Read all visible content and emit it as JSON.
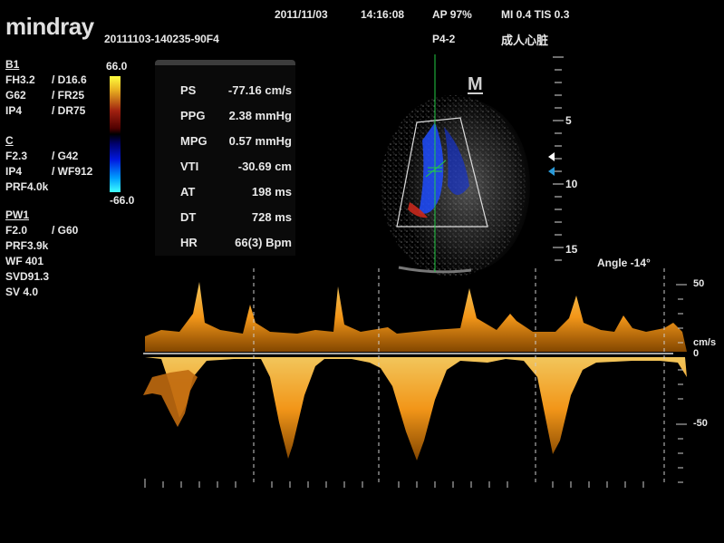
{
  "header": {
    "brand": "mindray",
    "file_id": "20111103-140235-90F4",
    "date": "2011/11/03",
    "time": "14:16:08",
    "ap": "AP  97%",
    "mi_tis": "MI 0.4  TIS 0.3",
    "probe": "P4-2",
    "exam": "成人心脏"
  },
  "params": {
    "b1": {
      "title": "B1",
      "r1a": "FH3.2",
      "r1b": "/ D16.6",
      "r2a": "G62",
      "r2b": "/ FR25",
      "r3a": "IP4",
      "r3b": "/ DR75"
    },
    "c": {
      "title": "C",
      "r1a": "F2.3",
      "r1b": "/ G42",
      "r2a": "IP4",
      "r2b": "/ WF912",
      "r3": "PRF4.0k"
    },
    "pw1": {
      "title": "PW1",
      "r1a": "F2.0",
      "r1b": "/ G60",
      "r2": "PRF3.9k",
      "r3": "WF 401",
      "r4": "SVD91.3",
      "r5": "SV 4.0"
    }
  },
  "color_scale": {
    "max": "66.0",
    "min": "-66.0"
  },
  "measurements": [
    {
      "label": "PS",
      "value": "-77.16 cm/s"
    },
    {
      "label": "PPG",
      "value": "2.38 mmHg"
    },
    {
      "label": "MPG",
      "value": "0.57 mmHg"
    },
    {
      "label": "VTI",
      "value": "-30.69 cm"
    },
    {
      "label": "AT",
      "value": "198 ms"
    },
    {
      "label": "DT",
      "value": "728 ms"
    },
    {
      "label": "HR",
      "value": "66(3) Bpm"
    }
  ],
  "image_view": {
    "marker": "M",
    "depth_labels": [
      "5",
      "10",
      "15"
    ],
    "angle": "Angle -14°"
  },
  "doppler": {
    "scale_labels": [
      "50",
      "cm/s",
      "0",
      "-50"
    ]
  },
  "colors": {
    "doppler": "#ff9e1a",
    "flow_blue": "#1e4cff",
    "flow_red": "#c8281c",
    "cursor": "#22cc44"
  }
}
